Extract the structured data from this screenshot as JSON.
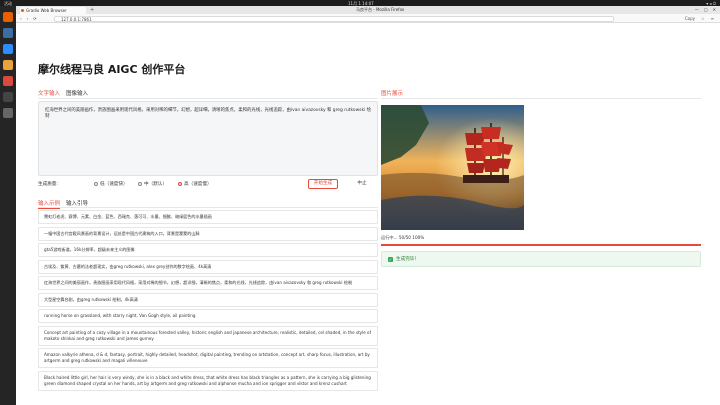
{
  "system_bar": {
    "left_text": "活动",
    "center_text": "11月 1 14:07",
    "right_text": "▾ ◂ ⏻"
  },
  "browser": {
    "tab_title": "Gradio Web Browser",
    "new_tab_symbol": "+",
    "window_title": "马良平台 - Mozilla Firefox",
    "window_controls": [
      "—",
      "▢",
      "✕"
    ],
    "url": "127.0.0.1:7861",
    "nav_buttons": [
      "‹",
      "›",
      "⟳"
    ],
    "nav_right": [
      "Copy",
      "☆",
      "≡"
    ]
  },
  "page": {
    "title": "摩尔线程马良 AIGC 创作平台",
    "input_tabs": [
      "文字输入",
      "图像输入"
    ],
    "prompt_text": "红海世界之间的美丽画作，贵族图画采用现代风格，采用对稀的细节，幻想，超详细，清晰的焦点，柔和的光线，光线追踪，由ivan aivazovsky 和 greg rutkowski 绘制",
    "quality_label": "生成质量:",
    "quality_options": [
      "低（速度快）",
      "中（默认）",
      "高（速度慢）"
    ],
    "quality_selected_index": 2,
    "start_button": "开始生成",
    "stop_button": "中止",
    "example_tabs": [
      "输入示例",
      "输入引导"
    ],
    "examples": [
      "霓虹灯老虎、赛博、元素、白金、蓝色、西瑞克、落可可、水墨、细腻、暗绿篮色的水墨插画",
      "一幅中国古代宫殿风景画的背景设计，远处是中国古代建筑的入口，背景是蒙蒙的山脉",
      "gta5游戏街道，16k分辨率，超级未来主义的图像",
      "古埃及、紫黄、古墓的法老超现实，由greg rutkowski, alex grey创作的数字绘画、4k高清",
      "红海世界之间的美丽画作，贵族图画采用现代风格，采用对稀的细节，幻想，超详细，清晰的焦点，柔和的光线，光线追踪，由ivan aivazovsky 和 greg rutkowski 绘制",
      "大型星空舞台剧，由greg rutkowski 绘制，4k高清",
      "running horse on grassland, with starry night, Van Gogh style, oil painting",
      "Concept art painting of a cozy village in a mountainous forested valley, historic english and japanese architecture, realistic, detailed, cel shaded, in the style of makoto shinkai and greg rutkowski and james gurney",
      "Amazon valkyrie athena, d & d, fantasy, portrait, highly detailed, headshot, digital painting, trending on artstation, concept art, sharp focus, illustration, art by artgerm and greg rutkowski and magali villeneuve",
      "Black haired little girl, her hair is very windy, she is in a black and white dress, that white dress has black triangles as a pattern, she is carrying a big glistening green diamond shaped crystal on her hands, art by artgerm and greg rutkowski and alphonse mucha and ion sprigger and viktor and krenz cushart"
    ],
    "output_title": "图片展示",
    "progress_text": "运行中... 50/50 100%",
    "progress_fraction": 1.0,
    "success_text": "生成完毕！",
    "success_icon": "✓"
  },
  "colors": {
    "accent": "#e84a3a",
    "success_bg": "#eef8f1",
    "success_text": "#2e7d32"
  }
}
